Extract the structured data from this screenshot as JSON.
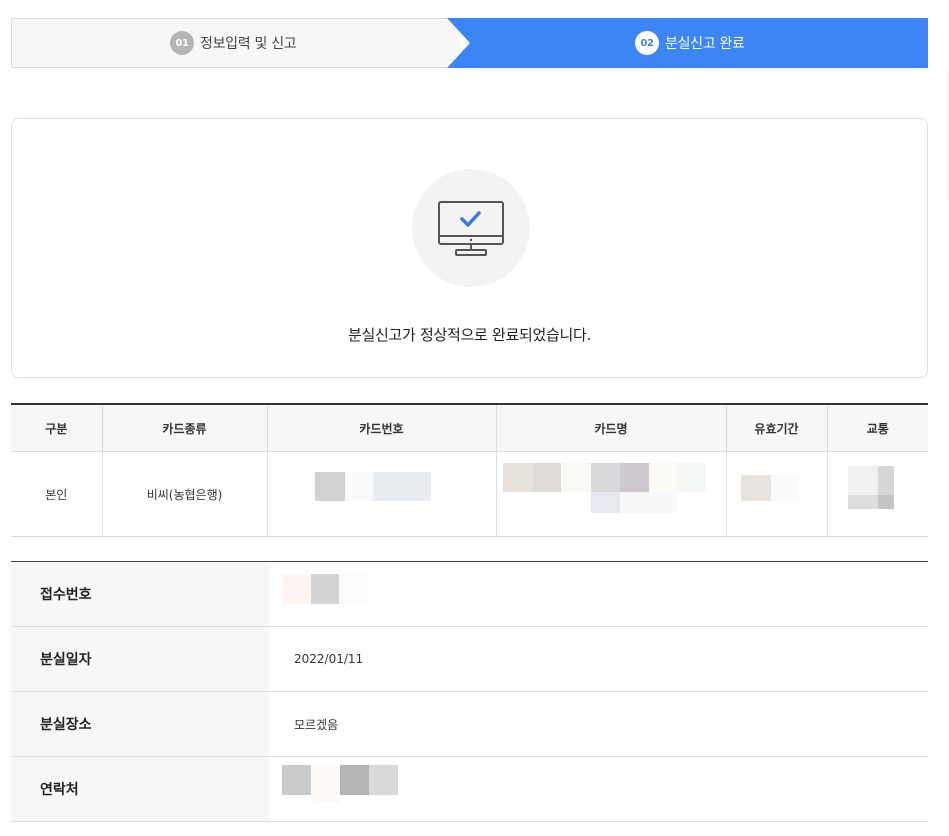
{
  "steps": [
    {
      "num": "01",
      "label": "정보입력 및 신고",
      "active": false
    },
    {
      "num": "02",
      "label": "분실신고 완료",
      "active": true
    }
  ],
  "result": {
    "icon": "monitor-check-icon",
    "message": "분실신고가 정상적으로 완료되었습니다."
  },
  "card_table": {
    "headers": [
      "구분",
      "카드종류",
      "카드번호",
      "카드명",
      "유효기간",
      "교통"
    ],
    "row": {
      "type": "본인",
      "card_kind": "비씨(농협은행)"
    }
  },
  "info": {
    "receipt_label": "접수번호",
    "lost_date_label": "분실일자",
    "lost_date": "2022/01/11",
    "lost_place_label": "분실장소",
    "lost_place": "모르겠음",
    "contact_label": "연락처"
  },
  "colors": {
    "accent": "#3b86f4",
    "check": "#3b7be6"
  }
}
